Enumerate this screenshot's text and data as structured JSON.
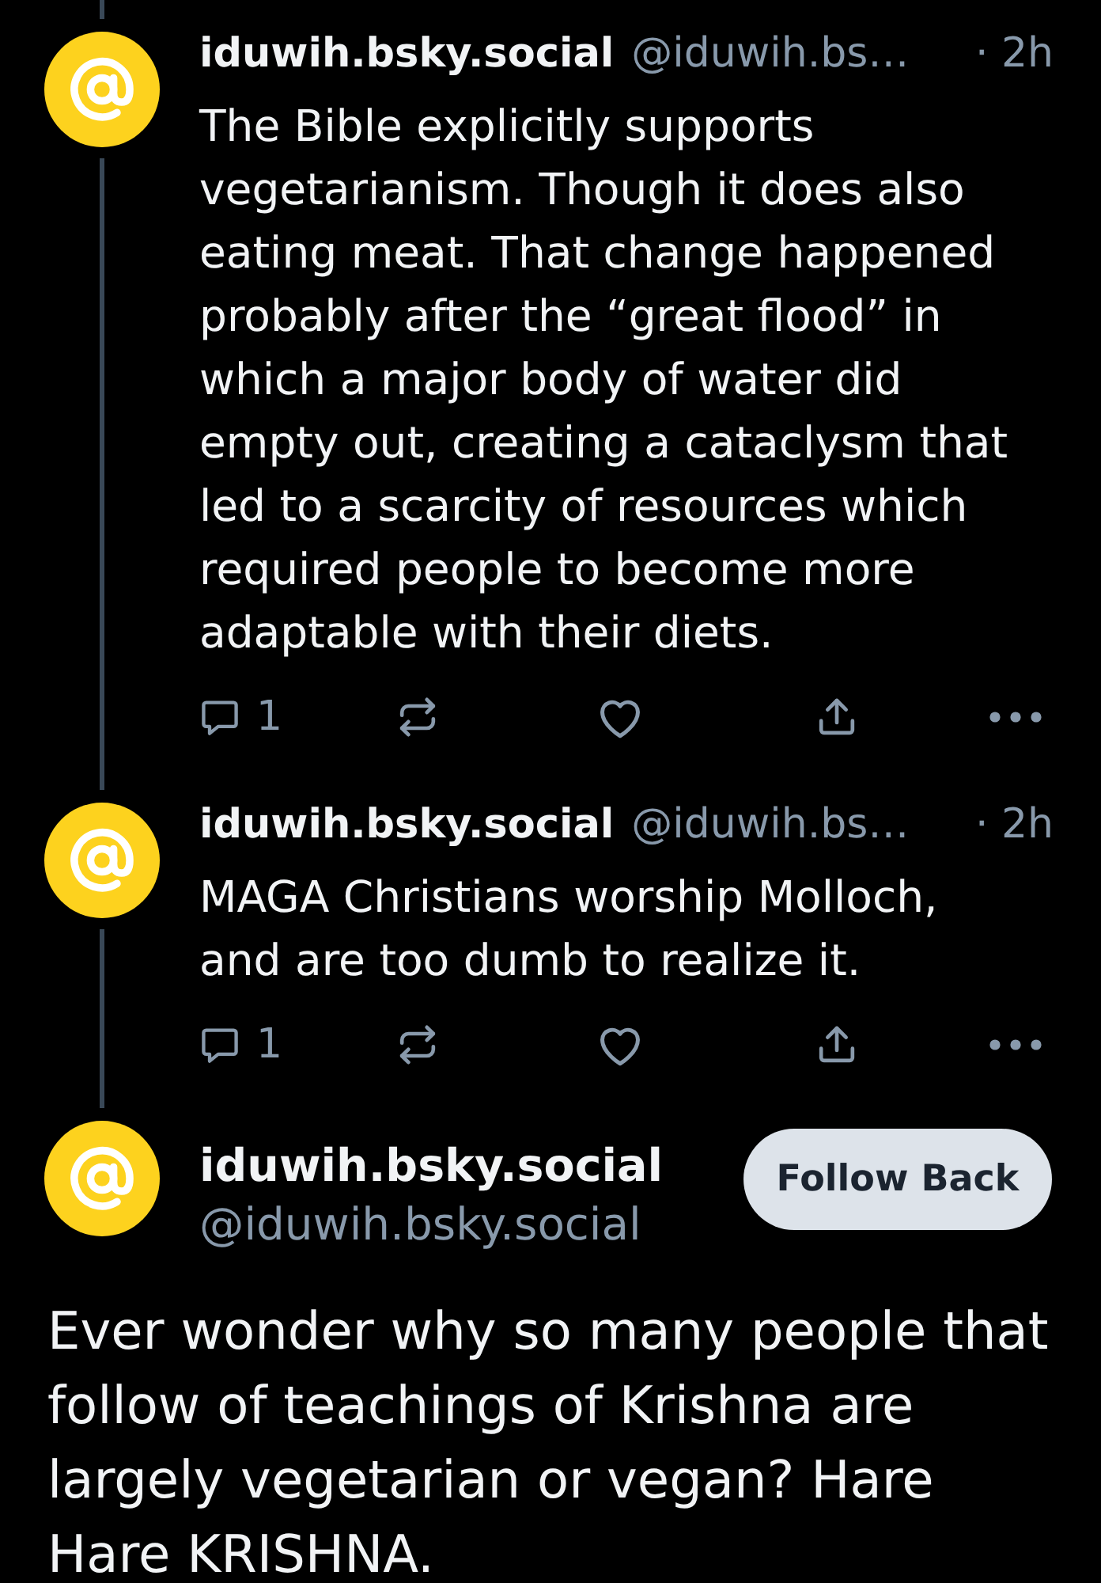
{
  "replies": [
    {
      "display_name": "iduwih.bsky.social",
      "handle": "@iduwih.bs…",
      "time": "· 2h",
      "text": "The Bible explicitly supports vegetarianism. Though it does also eating meat. That change happened probably after the “great flood” in which a major body of water did empty out, creating a cataclysm that led to a scarcity of resources which required people to become more adaptable with their diets.",
      "thread_above": true,
      "thread_below": true,
      "actions": [
        {
          "kind": "reply",
          "count": "1"
        },
        {
          "kind": "repost"
        },
        {
          "kind": "like"
        },
        {
          "kind": "share"
        },
        {
          "kind": "more"
        }
      ]
    },
    {
      "display_name": "iduwih.bsky.social",
      "handle": "@iduwih.bs…",
      "time": "· 2h",
      "text": "MAGA Christians worship Molloch, and are too dumb to realize it.",
      "thread_above": true,
      "thread_below": true,
      "actions": [
        {
          "kind": "reply",
          "count": "1"
        },
        {
          "kind": "repost"
        },
        {
          "kind": "like"
        },
        {
          "kind": "share"
        },
        {
          "kind": "more"
        }
      ]
    }
  ],
  "main_post": {
    "display_name": "iduwih.bsky.social",
    "handle": "@iduwih.bsky.social",
    "follow_button": "Follow Back",
    "thread_above": true,
    "text": "Ever wonder why so many people that follow of teachings of Krishna are largely vegetarian or vegan? Hare Hare KRISHNA."
  }
}
